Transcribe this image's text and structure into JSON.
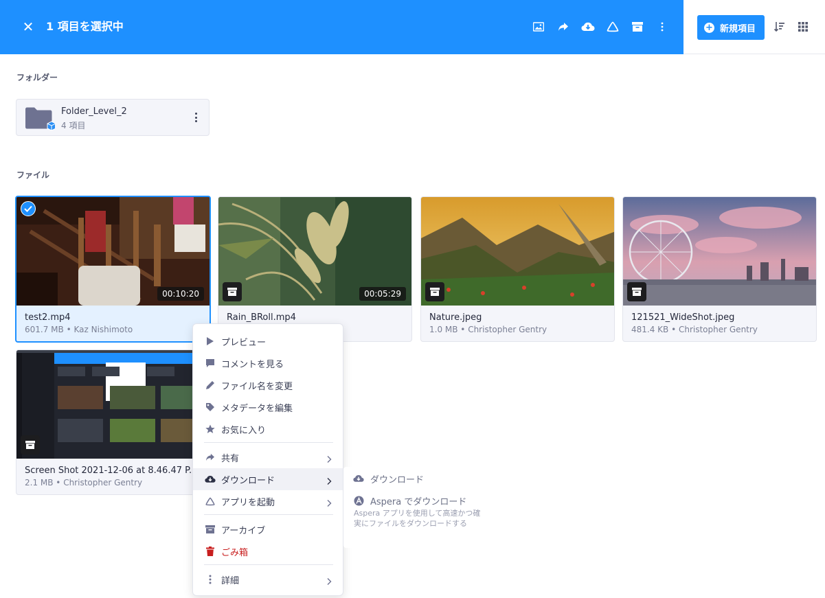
{
  "header": {
    "close_label": "✕",
    "selection_title": "1 項目を選択中",
    "icons": [
      "image-icon",
      "share-icon",
      "download-cloud-icon",
      "app-launch-icon",
      "archive-icon",
      "more-vertical-icon"
    ],
    "new_item_label": "新規項目"
  },
  "folders": {
    "section_label": "フォルダー",
    "items": [
      {
        "name": "Folder_Level_2",
        "sub": "4 項目"
      }
    ]
  },
  "files": {
    "section_label": "ファイル",
    "items": [
      {
        "name": "test2.mp4",
        "meta": "601.7 MB • Kaz Nishimoto",
        "duration": "00:10:20",
        "selected": true
      },
      {
        "name": "Rain_BRoll.mp4",
        "meta": "",
        "duration": "00:05:29",
        "selected": false
      },
      {
        "name": "Nature.jpeg",
        "meta": "1.0 MB • Christopher Gentry",
        "selected": false
      },
      {
        "name": "121521_WideShot.jpeg",
        "meta": "481.4 KB • Christopher Gentry",
        "selected": false
      },
      {
        "name": "Screen Shot 2021-12-06 at 8.46.47 P...",
        "meta": "2.1 MB • Christopher Gentry",
        "selected": false
      }
    ]
  },
  "context_menu": {
    "items": [
      {
        "label": "プレビュー",
        "icon": "play-icon"
      },
      {
        "label": "コメントを見る",
        "icon": "comment-icon"
      },
      {
        "label": "ファイル名を変更",
        "icon": "pencil-icon"
      },
      {
        "label": "メタデータを編集",
        "icon": "tag-icon"
      },
      {
        "label": "お気に入り",
        "icon": "star-icon"
      },
      {
        "label": "共有",
        "icon": "share-icon"
      },
      {
        "label": "ダウンロード",
        "icon": "download-cloud-icon"
      },
      {
        "label": "アプリを起動",
        "icon": "app-launch-icon"
      },
      {
        "label": "アーカイブ",
        "icon": "archive-icon"
      },
      {
        "label": "ごみ箱",
        "icon": "trash-icon"
      },
      {
        "label": "詳細",
        "icon": "more-vertical-icon"
      }
    ]
  },
  "download_submenu": {
    "items": [
      {
        "label": "ダウンロード",
        "icon": "download-cloud-icon"
      },
      {
        "label": "Aspera でダウンロード",
        "icon": "aspera-icon",
        "description": "Aspera アプリを使用して高速かつ確実にファイルをダウンロードする"
      }
    ]
  },
  "colors": {
    "accent": "#1e90ff",
    "danger": "#c81e1e",
    "text": "#3a3f55"
  }
}
